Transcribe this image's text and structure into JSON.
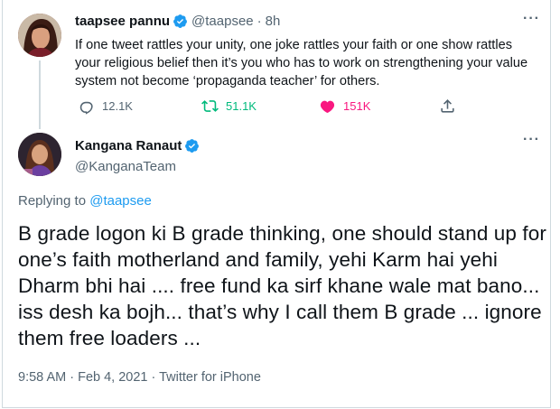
{
  "original_tweet": {
    "author_name": "taapsee pannu",
    "author_handle": "@taapsee",
    "separator": "·",
    "time": "8h",
    "avatar_icon": "user-avatar",
    "text": "If one tweet rattles your unity, one joke rattles your faith or one show rattles your religious belief then it’s you who has to work on strengthening your value system not become ‘propaganda teacher’ for others.",
    "actions": {
      "replies": "12.1K",
      "retweets": "51.1K",
      "likes": "151K"
    }
  },
  "reply_tweet": {
    "author_name": "Kangana Ranaut",
    "author_handle": "@KanganaTeam",
    "avatar_icon": "user-avatar",
    "replying_prefix": "Replying to",
    "replying_to": "@taapsee",
    "text": "B grade logon ki B grade thinking, one should stand up for one’s faith motherland and family, yehi Karm hai yehi Dharm bhi hai .... free fund ka sirf khane wale mat bano... iss desh ka bojh... that’s why I call them B grade ... ignore them free loaders ...",
    "timestamp": "9:58 AM · Feb 4, 2021 · Twitter for iPhone"
  },
  "more_label": "···",
  "colors": {
    "verified_blue": "#1d9bf0",
    "retweet_green": "#00ba7c",
    "like_pink": "#f91880",
    "secondary_text": "#536471"
  }
}
